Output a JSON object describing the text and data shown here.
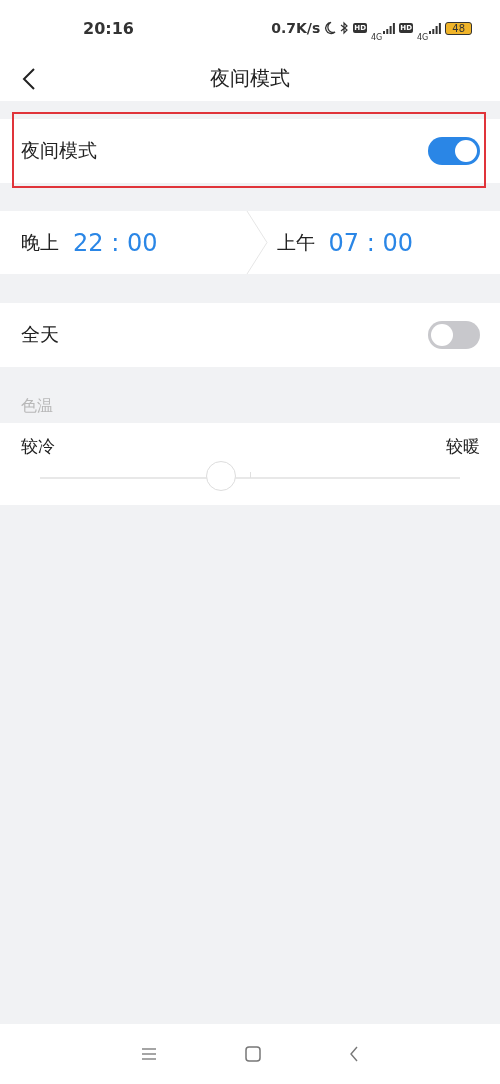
{
  "status_bar": {
    "time": "20:16",
    "speed": "0.7K/s",
    "sims": [
      {
        "badge": "HD",
        "network": "4G"
      },
      {
        "badge": "HD",
        "network": "4G"
      }
    ],
    "battery": "48"
  },
  "header": {
    "title": "夜间模式"
  },
  "night_mode": {
    "label": "夜间模式",
    "on": true,
    "highlighted": true
  },
  "schedule": {
    "start": {
      "period": "晚上",
      "time": "22 : 00"
    },
    "end": {
      "period": "上午",
      "time": "07 : 00"
    }
  },
  "all_day": {
    "label": "全天",
    "on": false
  },
  "color_temperature": {
    "section": "色温",
    "min_label": "较冷",
    "max_label": "较暖",
    "level": 0.43
  }
}
